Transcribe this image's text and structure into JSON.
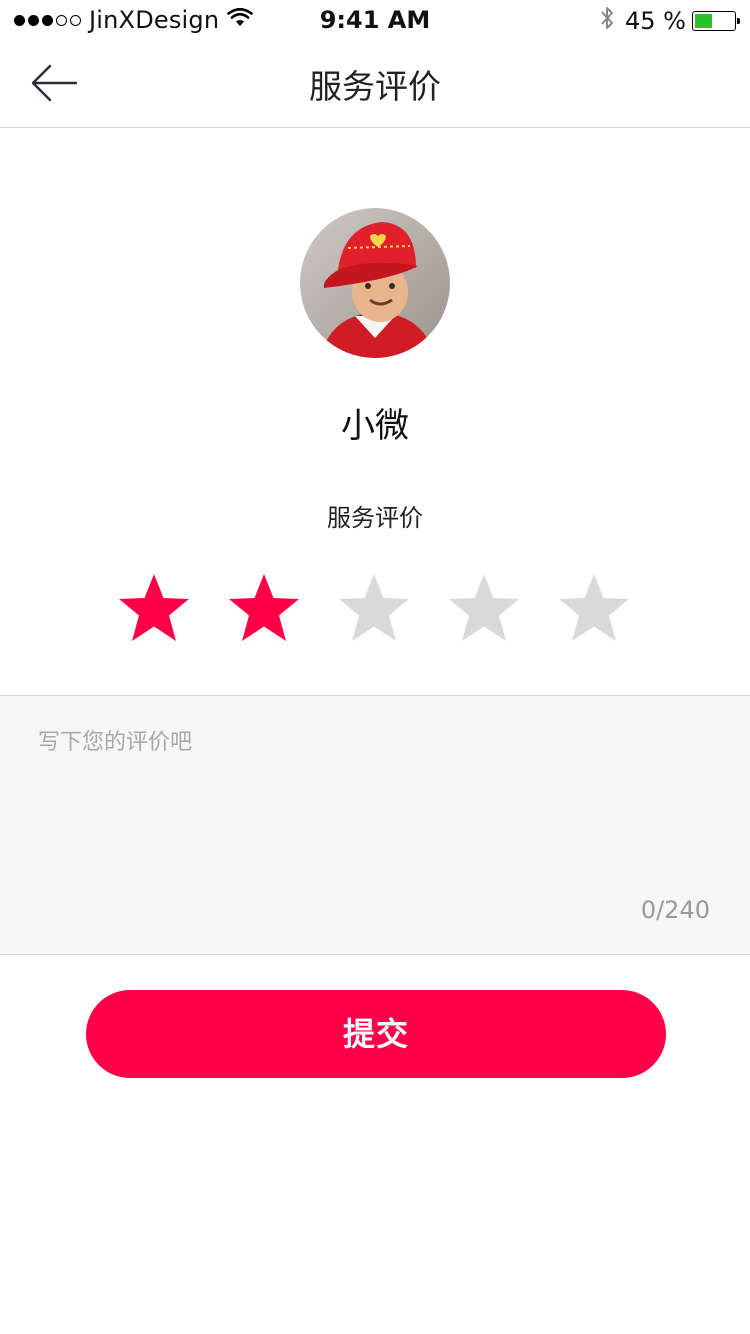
{
  "status_bar": {
    "carrier": "JinXDesign",
    "time": "9:41 AM",
    "battery_text": "45 %",
    "battery_level": 0.45,
    "signal_filled": 3,
    "signal_total": 5
  },
  "nav": {
    "title": "服务评价",
    "back_icon": "arrow-left-icon"
  },
  "profile": {
    "name": "小微"
  },
  "rating": {
    "label": "服务评价",
    "value": 2,
    "max": 5,
    "active_color": "#ff0048",
    "inactive_color": "#d9d9d9"
  },
  "review": {
    "placeholder": "写下您的评价吧",
    "value": "",
    "counter": "0/240"
  },
  "submit_label": "提交",
  "colors": {
    "accent": "#ff0048",
    "battery": "#2dc22d"
  }
}
